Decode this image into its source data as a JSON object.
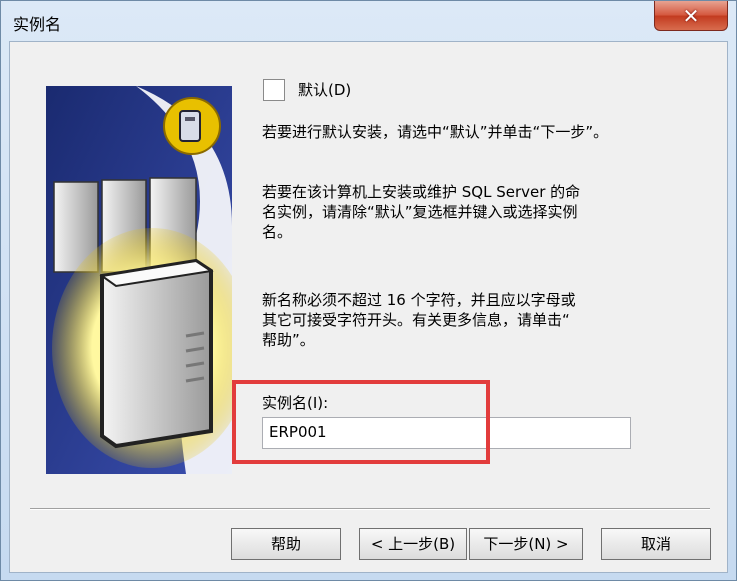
{
  "window": {
    "title": "实例名",
    "close_symbol": "✕"
  },
  "content": {
    "default_checkbox_label": "默认(D)",
    "default_desc": "若要进行默认安装，请选中“默认”并单击“下一步”。",
    "named_desc_1": "若要在该计算机上安装或维护 SQL Server 的命",
    "named_desc_2": "名实例，请清除“默认”复选框并键入或选择实例",
    "named_desc_3": "名。",
    "rule_1": "新名称必须不超过 16 个字符，并且应以字母或",
    "rule_2": "其它可接受字符开头。有关更多信息，请单击“",
    "rule_3": "帮助”。",
    "instance_label": "实例名(I):",
    "instance_value": "ERP001"
  },
  "buttons": {
    "help": "帮助",
    "back": "< 上一步(B)",
    "next": "下一步(N) >",
    "cancel": "取消"
  },
  "colors": {
    "highlight": "#e23c3c",
    "close": "#c23a1f"
  }
}
